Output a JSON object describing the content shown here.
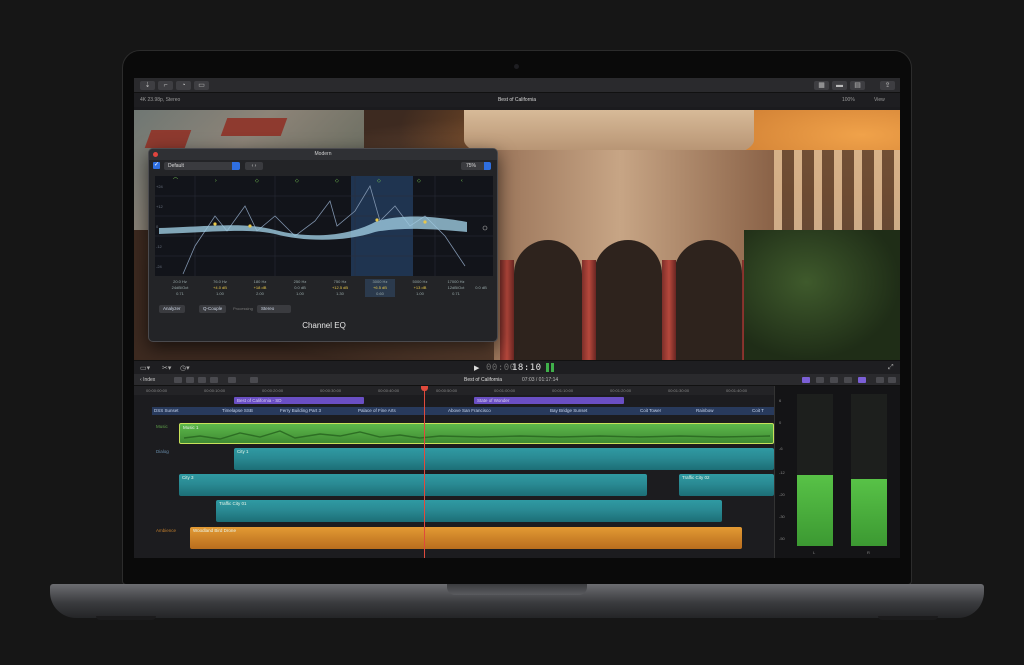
{
  "toolbar": {
    "format": "4K 23.98p, Stereo",
    "project_title": "Best of California",
    "zoom": "100%",
    "view": "View"
  },
  "eq": {
    "window_title": "Modern",
    "preset": "Default",
    "amount": "75%",
    "plugin_name": "Channel EQ",
    "analyzer": "Analyzer",
    "q_couple": "Q-Couple",
    "processing_label": "Processing",
    "processing_value": "Stereo",
    "bands": [
      {
        "freq": "20.0 Hz",
        "gain": "24dB/Oct",
        "q": "0.71"
      },
      {
        "freq": "76.0 Hz",
        "gain": "+4.0 dB",
        "q": "1.00"
      },
      {
        "freq": "180 Hz",
        "gain": "+18 dB",
        "q": "2.00"
      },
      {
        "freq": "250 Hz",
        "gain": "0.0 dB",
        "q": "1.00"
      },
      {
        "freq": "750 Hz",
        "gain": "+12.5 dB",
        "q": "1.30"
      },
      {
        "freq": "3000 Hz",
        "gain": "+6.5 dB",
        "q": "0.60"
      },
      {
        "freq": "5000 Hz",
        "gain": "+13 dB",
        "q": "1.00"
      },
      {
        "freq": "17000 Hz",
        "gain": "12dB/Oct",
        "q": "0.71"
      }
    ],
    "output_gain": "0.0 dB"
  },
  "transport": {
    "timecode": "18:10",
    "play_icon": "play-icon"
  },
  "timeline_header": {
    "index_label": "Index",
    "project": "Best of California",
    "duration": "07:03 / 01:17:14"
  },
  "timeline": {
    "ruler": [
      "00:00:00:00",
      "00:00:10:00",
      "00:00:20:00",
      "00:00:30:00",
      "00:00:40:00",
      "00:00:50:00",
      "00:01:00:00",
      "00:01:10:00",
      "00:01:20:00",
      "00:01:30:00",
      "00:01:40:00"
    ],
    "titles": [
      "Best of California - SD",
      "State of Wonder"
    ],
    "markers": [
      "DSS Sunset",
      "Timelapse SSB",
      "Ferry Building Part 3",
      "Palace of Fine Arts",
      "Above San Francisco",
      "Bay Bridge Sunset",
      "Coit Tower",
      "Rainbow",
      "Coit T"
    ],
    "roles": {
      "music": "Music",
      "dialogue": "Dialog",
      "ambience": "Ambience"
    },
    "clips": {
      "music": "Music 1",
      "city1": "City 1",
      "city3": "City 3",
      "traffic": "Traffic City 01",
      "traffic2": "Traffic City 02",
      "ambience": "Woodland Bird Drone"
    }
  },
  "meters": {
    "scale": [
      "6",
      "0",
      "-6",
      "-12",
      "-20",
      "-30",
      "-50"
    ],
    "left_level": 0.47,
    "right_level": 0.44,
    "channels": [
      "L",
      "R"
    ]
  }
}
